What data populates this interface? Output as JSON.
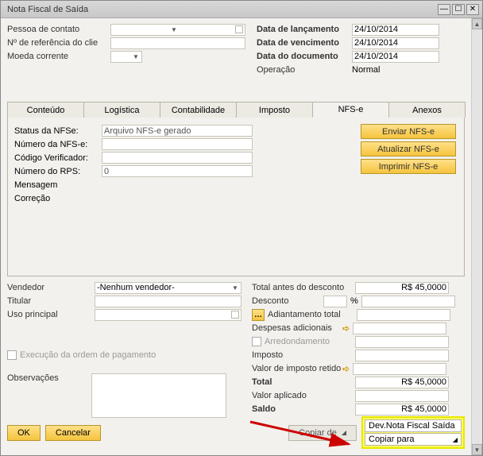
{
  "window": {
    "title": "Nota Fiscal de Saída"
  },
  "header": {
    "left": {
      "pessoa_label": "Pessoa de contato",
      "ref_label": "Nº de referência do clie",
      "moeda_label": "Moeda corrente"
    },
    "right": {
      "lanc_label": "Data de lançamento",
      "lanc_val": "24/10/2014",
      "venc_label": "Data de vencimento",
      "venc_val": "24/10/2014",
      "doc_label": "Data do documento",
      "doc_val": "24/10/2014",
      "oper_label": "Operação",
      "oper_val": "Normal"
    }
  },
  "tabs": {
    "items": [
      "Conteúdo",
      "Logística",
      "Contabilidade",
      "Imposto",
      "NFS-e",
      "Anexos"
    ],
    "active": 4
  },
  "nfse": {
    "status_label": "Status da NFSe:",
    "status_val": "Arquivo NFS-e gerado",
    "num_label": "Número da NFS-e:",
    "cod_label": "Código Verificador:",
    "rps_label": "Número do RPS:",
    "rps_val": "0",
    "msg_label": "Mensagem",
    "corr_label": "Correção",
    "buttons": {
      "enviar": "Enviar NFS-e",
      "atualizar": "Atualizar NFS-e",
      "imprimir": "Imprimir NFS-e"
    }
  },
  "bottom_left": {
    "vendedor_label": "Vendedor",
    "vendedor_val": "-Nenhum vendedor-",
    "titular_label": "Titular",
    "uso_label": "Uso principal",
    "exec_label": "Execução da ordem de pagamento",
    "obs_label": "Observações"
  },
  "totals": {
    "total_antes_label": "Total antes do desconto",
    "total_antes_val": "R$ 45,0000",
    "desconto_label": "Desconto",
    "desconto_pct": "%",
    "adiant_label": "Adiantamento total",
    "desp_label": "Despesas adicionais",
    "arred_label": "Arredondamento",
    "imposto_label": "Imposto",
    "valor_ret_label": "Valor de imposto retido",
    "total_label": "Total",
    "total_val": "R$ 45,0000",
    "valor_ap_label": "Valor aplicado",
    "saldo_label": "Saldo",
    "saldo_val": "R$ 45,0000"
  },
  "footer": {
    "ok": "OK",
    "cancelar": "Cancelar",
    "copiar_de": "Copiar de",
    "highlight": {
      "line1": "Dev.Nota Fiscal Saída",
      "line2": "Copiar para"
    }
  }
}
